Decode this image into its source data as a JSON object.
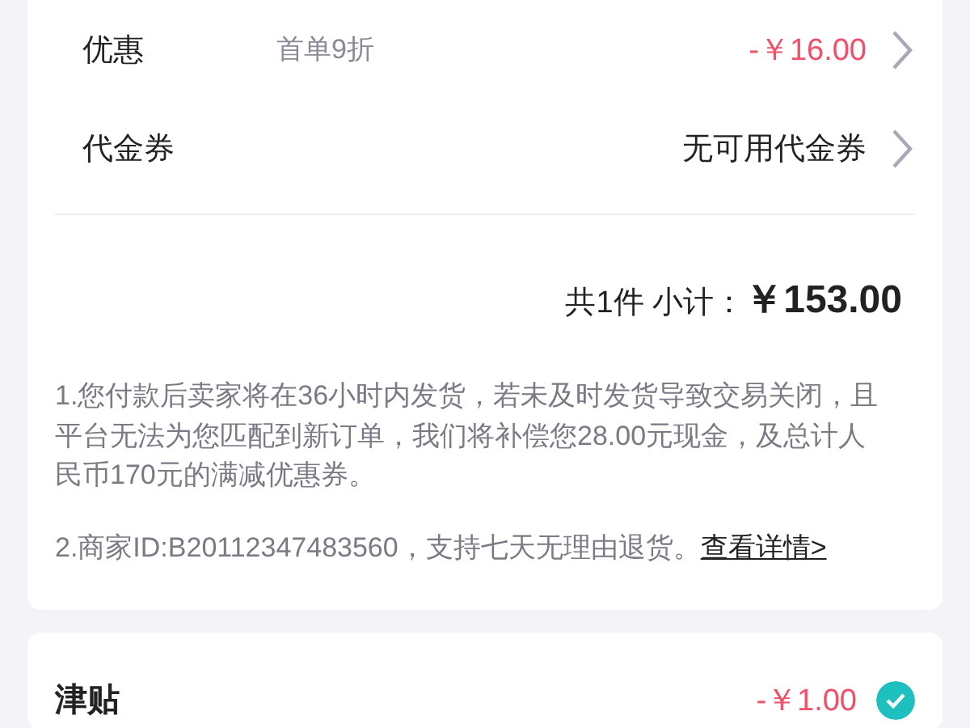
{
  "discount_rows": [
    {
      "kind": "discount",
      "label": "优惠",
      "note": "首单9折",
      "value": "-￥16.00"
    },
    {
      "kind": "voucher",
      "label": "代金券",
      "value": "无可用代金券"
    }
  ],
  "subtotal": {
    "count": "共1件 小计：",
    "amount": "￥153.00"
  },
  "notes": [
    {
      "text": "1.您付款后卖家将在36小时内发货，若未及时发货导致交易关闭，且平台无法为您匹配到新订单，我们将补偿您28.00元现金，及总计人民币170元的满减优惠券。"
    },
    {
      "text": "2.商家ID:B20112347483560，支持七天无理由退货。",
      "link": "查看详情>"
    }
  ],
  "subsidy": {
    "label": "津贴",
    "value": "-￥1.00",
    "checked": true
  }
}
